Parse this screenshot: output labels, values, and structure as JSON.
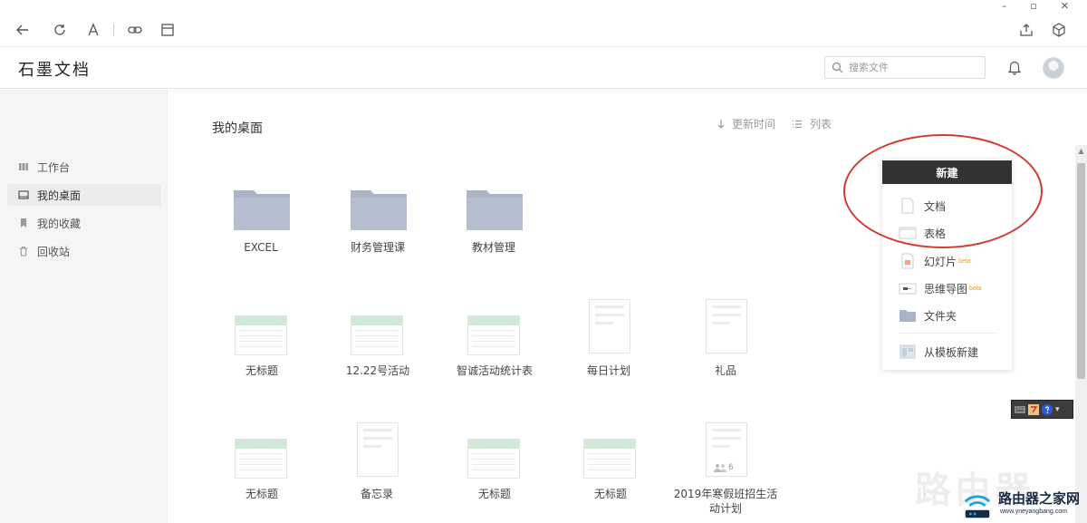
{
  "app": {
    "brand": "石墨文档"
  },
  "search": {
    "placeholder": "搜索文件"
  },
  "sidebar": {
    "items": [
      {
        "label": "工作台",
        "icon": "workbench-icon",
        "active": false
      },
      {
        "label": "我的桌面",
        "icon": "desktop-icon",
        "active": true
      },
      {
        "label": "我的收藏",
        "icon": "bookmark-icon",
        "active": false
      },
      {
        "label": "回收站",
        "icon": "trash-icon",
        "active": false
      }
    ]
  },
  "main": {
    "title": "我的桌面",
    "sort_label": "更新时间",
    "view_label": "列表",
    "files": [
      {
        "name": "EXCEL",
        "type": "folder"
      },
      {
        "name": "财务管理课",
        "type": "folder"
      },
      {
        "name": "教材管理",
        "type": "folder"
      },
      {
        "name": "无标题",
        "type": "sheet"
      },
      {
        "name": "12.22号活动",
        "type": "sheet"
      },
      {
        "name": "智诚活动统计表",
        "type": "sheet"
      },
      {
        "name": "每日计划",
        "type": "doc"
      },
      {
        "name": "礼品",
        "type": "doc"
      },
      {
        "name": "无标题",
        "type": "sheet"
      },
      {
        "name": "备忘录",
        "type": "doc"
      },
      {
        "name": "无标题",
        "type": "sheet"
      },
      {
        "name": "无标题",
        "type": "sheet"
      },
      {
        "name": "2019年寒假班招生活动计划",
        "type": "doc",
        "shared_count": "6"
      }
    ]
  },
  "new_menu": {
    "button": "新建",
    "items": [
      {
        "label": "文档",
        "icon": "doc-icon",
        "badge": ""
      },
      {
        "label": "表格",
        "icon": "sheet-icon",
        "badge": ""
      },
      {
        "label": "幻灯片",
        "icon": "slides-icon",
        "badge": "beta"
      },
      {
        "label": "思维导图",
        "icon": "mindmap-icon",
        "badge": "beta"
      },
      {
        "label": "文件夹",
        "icon": "folder-icon",
        "badge": ""
      },
      {
        "label": "从模板新建",
        "icon": "template-icon",
        "badge": ""
      }
    ]
  },
  "watermark": {
    "big": "路由器",
    "name": "路由器之家网",
    "url": "www.yneyangbang.com"
  },
  "colors": {
    "accent": "#333333",
    "folder": "#a9b4c6",
    "sheet_header": "#cfe9d6",
    "annotation": "#d23a32"
  }
}
